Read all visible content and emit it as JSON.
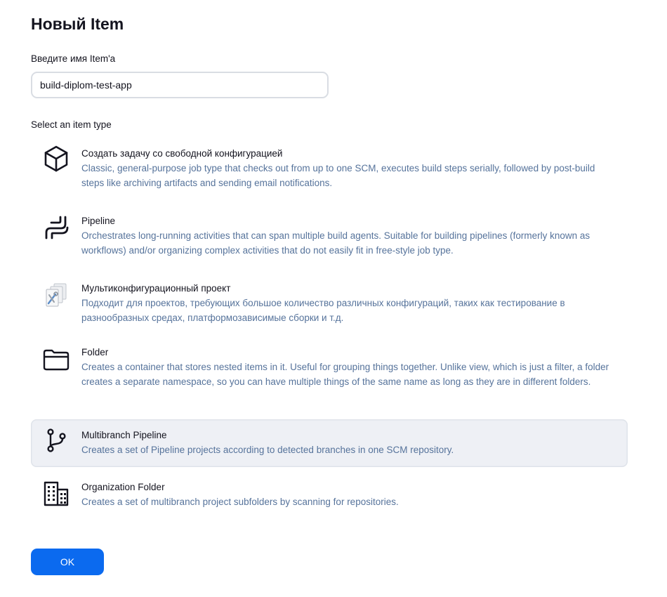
{
  "page": {
    "title": "Новый Item"
  },
  "name_field": {
    "label": "Введите имя Item'a",
    "value": "build-diplom-test-app"
  },
  "item_types": {
    "label": "Select an item type",
    "items": [
      {
        "name": "Создать задачу со свободной конфигурацией",
        "description": "Classic, general-purpose job type that checks out from up to one SCM, executes build steps serially, followed by post-build steps like archiving artifacts and sending email notifications.",
        "icon": "freestyle-cube-icon",
        "selected": false
      },
      {
        "name": "Pipeline",
        "description": "Orchestrates long-running activities that can span multiple build agents. Suitable for building pipelines (formerly known as workflows) and/or organizing complex activities that do not easily fit in free-style job type.",
        "icon": "pipeline-icon",
        "selected": false
      },
      {
        "name": "Мультиконфигурационный проект",
        "description": "Подходит для проектов, требующих большое количество различных конфигураций, таких как тестирование в разнообразных средах, платформозависимые сборки и т.д.",
        "icon": "matrix-project-icon",
        "selected": false
      },
      {
        "name": "Folder",
        "description": "Creates a container that stores nested items in it. Useful for grouping things together. Unlike view, which is just a filter, a folder creates a separate namespace, so you can have multiple things of the same name as long as they are in different folders.",
        "icon": "folder-icon",
        "selected": false
      },
      {
        "name": "Multibranch Pipeline",
        "description": "Creates a set of Pipeline projects according to detected branches in one SCM repository.",
        "icon": "git-branch-icon",
        "selected": true
      },
      {
        "name": "Organization Folder",
        "description": "Creates a set of multibranch project subfolders by scanning for repositories.",
        "icon": "organization-building-icon",
        "selected": false
      }
    ]
  },
  "actions": {
    "ok_label": "OK"
  },
  "colors": {
    "accent": "#0b6aef",
    "description_text": "#56739b",
    "selected_background": "#eef0f5"
  }
}
